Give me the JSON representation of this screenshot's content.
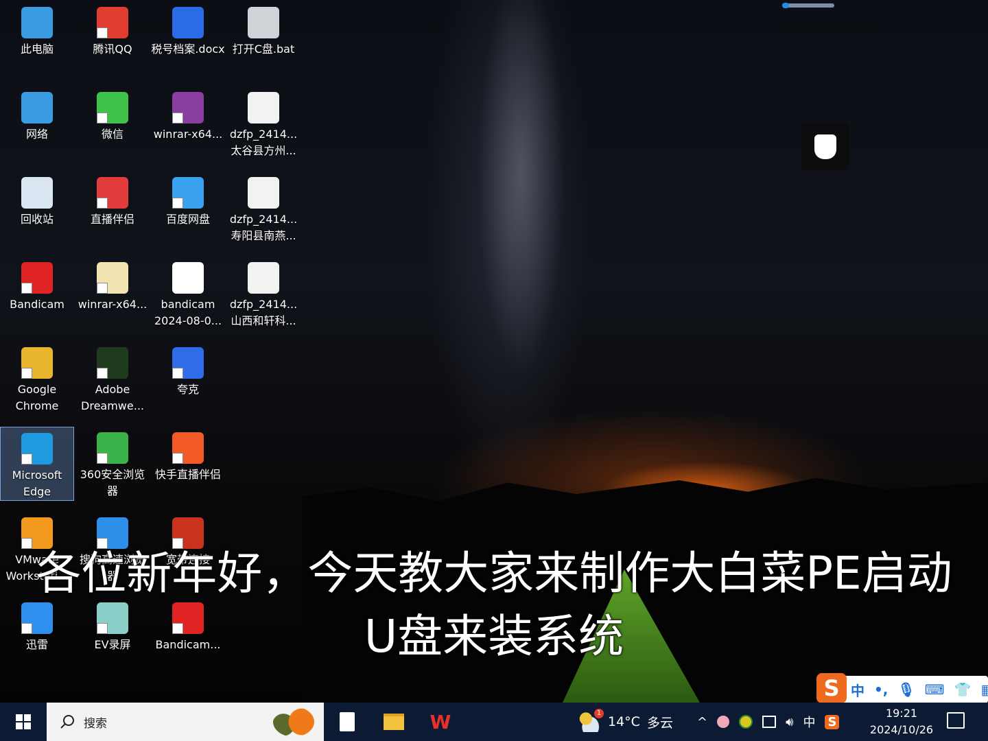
{
  "desktop_icons": [
    {
      "label": "此电脑",
      "color": "#3a9be0"
    },
    {
      "label": "腾讯QQ",
      "color": "#e23b2f"
    },
    {
      "label": "税号档案.docx",
      "color": "#2b6be5"
    },
    {
      "label": "打开C盘.bat",
      "color": "#cfd3d8"
    },
    {
      "label": "网络",
      "color": "#3a9be0"
    },
    {
      "label": "微信",
      "color": "#3fc24a"
    },
    {
      "label": "winrar-x64...",
      "color": "#8a3fa0"
    },
    {
      "label": "dzfp_2414...太谷县方州...",
      "color": "#f2f2f2"
    },
    {
      "label": "回收站",
      "color": "#d9e6f2"
    },
    {
      "label": "直播伴侣",
      "color": "#e33b3b"
    },
    {
      "label": "百度网盘",
      "color": "#3aa0f0"
    },
    {
      "label": "dzfp_2414...寿阳县南燕...",
      "color": "#f2f2f2"
    },
    {
      "label": "Bandicam",
      "color": "#e02424"
    },
    {
      "label": "winrar-x64...",
      "color": "#f1e4b0"
    },
    {
      "label": "bandicam 2024-08-0...",
      "color": "#ffffff"
    },
    {
      "label": "dzfp_2414...山西和轩科...",
      "color": "#f2f2f2"
    },
    {
      "label": "Google Chrome",
      "color": "#e8b52c"
    },
    {
      "label": "Adobe Dreamwe...",
      "color": "#1f3a1c"
    },
    {
      "label": "夸克",
      "color": "#2f6de8"
    },
    {
      "label": "Microsoft Edge",
      "color": "#1d9ae0"
    },
    {
      "label": "360安全浏览器",
      "color": "#3bb34a"
    },
    {
      "label": "快手直播伴侣",
      "color": "#f25a28"
    },
    {
      "label": "VMware Workstati...",
      "color": "#f39a1e"
    },
    {
      "label": "搜狗高速浏览器",
      "color": "#2d8fe8"
    },
    {
      "label": "宽带连接",
      "color": "#c8321e"
    },
    {
      "label": "迅雷",
      "color": "#2f8fee"
    },
    {
      "label": "EV录屏",
      "color": "#8ad0c8"
    },
    {
      "label": "Bandicam...",
      "color": "#e02424"
    }
  ],
  "subtitle": {
    "line1": "各位新年好，今天教大家来制作大白菜PE启动",
    "line2": "U盘来装系统"
  },
  "ime_bar": {
    "logo": "S",
    "mode": "中",
    "punct": "•,",
    "mic": "🎙",
    "keyboard": "⌨",
    "skin": "👕",
    "apps": "▦"
  },
  "taskbar": {
    "search_placeholder": "搜索",
    "weather": {
      "temp": "14°C",
      "condition": "多云",
      "badge": "1"
    },
    "tray": {
      "chevron": "^",
      "lang": "中",
      "ime": "S"
    },
    "time": "19:21",
    "date": "2024/10/26"
  }
}
